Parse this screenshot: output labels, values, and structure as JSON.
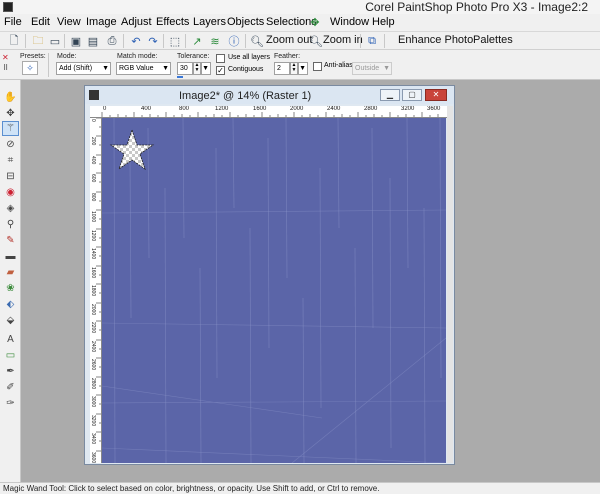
{
  "app": {
    "title": "Corel PaintShop Photo Pro X3 - Image2:2"
  },
  "menu": {
    "file": "File",
    "edit": "Edit",
    "view": "View",
    "image": "Image",
    "adjust": "Adjust",
    "effects": "Effects",
    "layers": "Layers",
    "objects": "Objects",
    "selections": "Selections",
    "window": "Window",
    "help": "Help"
  },
  "toolbar": {
    "zoom_out": "Zoom out",
    "zoom_in": "Zoom in",
    "enhance_photo": "Enhance Photo",
    "palettes": "Palettes"
  },
  "options": {
    "presets_label": "Presets:",
    "mode_label": "Mode:",
    "mode_value": "Add (Shift)",
    "match_label": "Match mode:",
    "match_value": "RGB Value",
    "tolerance_label": "Tolerance:",
    "tolerance_value": "30",
    "use_all_layers": "Use all layers",
    "use_all_layers_checked": false,
    "contiguous": "Contiguous",
    "contiguous_checked": true,
    "feather_label": "Feather:",
    "feather_value": "2",
    "anti_alias": "Anti-alias",
    "anti_alias_checked": false,
    "aa_mode_value": "Outside"
  },
  "image_window": {
    "title": "Image2* @  14% (Raster 1)",
    "ruler_top": [
      "0",
      "400",
      "800",
      "1200",
      "1600",
      "2000",
      "2400",
      "2800",
      "3200",
      "3600"
    ],
    "ruler_left": [
      "0",
      "200",
      "400",
      "600",
      "800",
      "1000",
      "1200",
      "1400",
      "1600",
      "1800",
      "2000",
      "2200",
      "2400",
      "2600",
      "2800",
      "3000",
      "3200",
      "3400",
      "3600"
    ]
  },
  "status": {
    "text": "Magic Wand Tool: Click to select based on color, brightness, or opacity. Use Shift to add, or Ctrl to remove."
  },
  "colors": {
    "canvas": "#5b65a8",
    "workspace": "#ababab",
    "accent": "#3a78d8"
  }
}
